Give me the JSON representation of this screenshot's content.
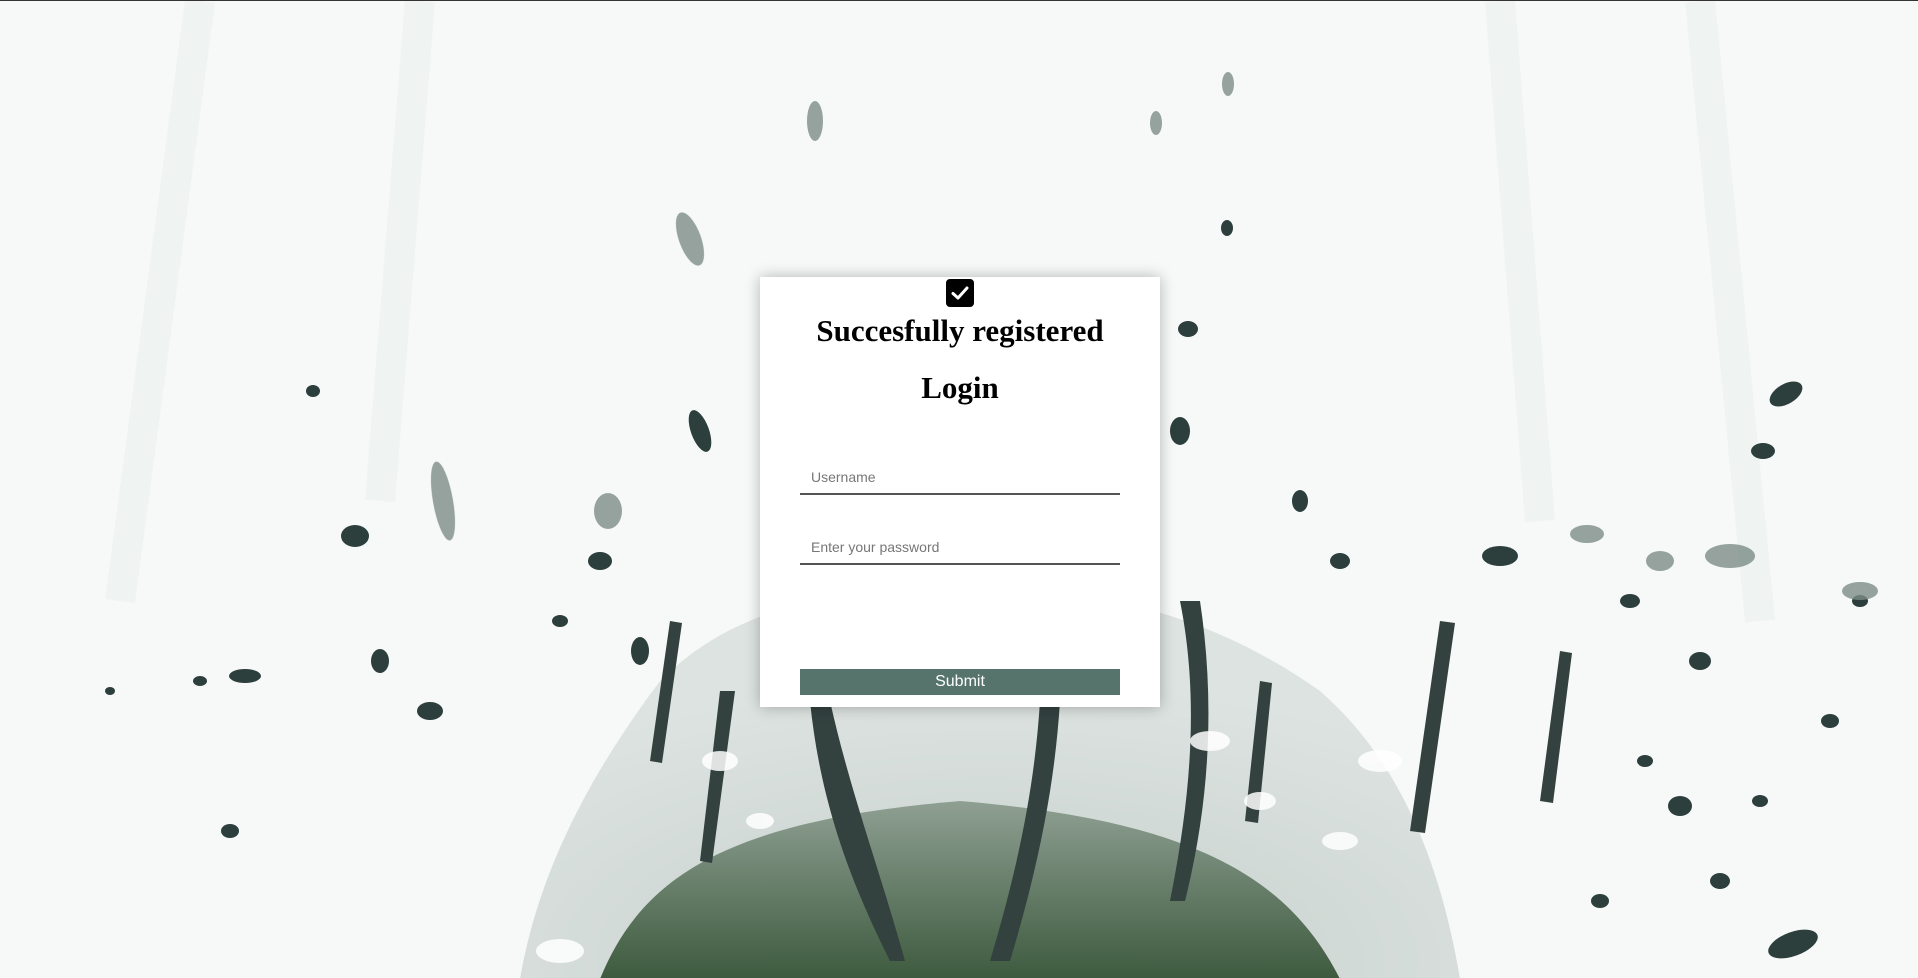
{
  "login_card": {
    "success_message": "Succesfully registered",
    "title": "Login",
    "username": {
      "placeholder": "Username",
      "value": ""
    },
    "password": {
      "placeholder": "Enter your password",
      "value": ""
    },
    "submit_label": "Submit",
    "status_icon": "checkmark-icon"
  },
  "colors": {
    "submit_button": "#56736c",
    "card_background": "#ffffff",
    "page_background": "#f6f8f7",
    "forest_foliage": "#2d3f3c"
  }
}
